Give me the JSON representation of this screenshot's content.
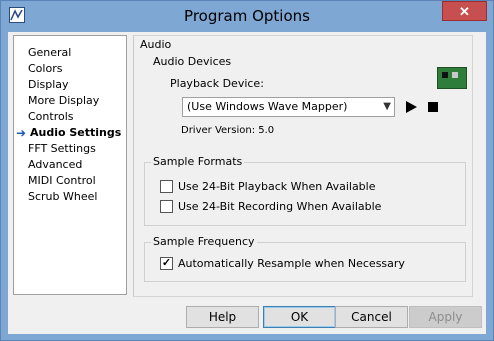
{
  "window": {
    "title": "Program Options",
    "close_label": "✕"
  },
  "nav": {
    "items": [
      {
        "label": "General"
      },
      {
        "label": "Colors"
      },
      {
        "label": "Display"
      },
      {
        "label": "More Display"
      },
      {
        "label": "Controls"
      },
      {
        "label": "Audio Settings",
        "selected": true
      },
      {
        "label": "FFT Settings"
      },
      {
        "label": "Advanced"
      },
      {
        "label": "MIDI Control"
      },
      {
        "label": "Scrub Wheel"
      }
    ]
  },
  "panel": {
    "heading": "Audio",
    "audio_devices": {
      "group_label": "Audio Devices",
      "playback_label": "Playback Device:",
      "device_selected": "(Use Windows Wave Mapper)",
      "driver_version": "Driver Version: 5.0"
    },
    "sample_formats": {
      "group_label": "Sample Formats",
      "opt_24bit_playback": {
        "label": "Use 24-Bit Playback When Available",
        "checked": false
      },
      "opt_24bit_recording": {
        "label": "Use 24-Bit Recording When Available",
        "checked": false
      }
    },
    "sample_frequency": {
      "group_label": "Sample Frequency",
      "opt_resample": {
        "label": "Automatically Resample when Necessary",
        "checked": true
      }
    }
  },
  "buttons": {
    "help": "Help",
    "ok": "OK",
    "cancel": "Cancel",
    "apply": "Apply"
  }
}
